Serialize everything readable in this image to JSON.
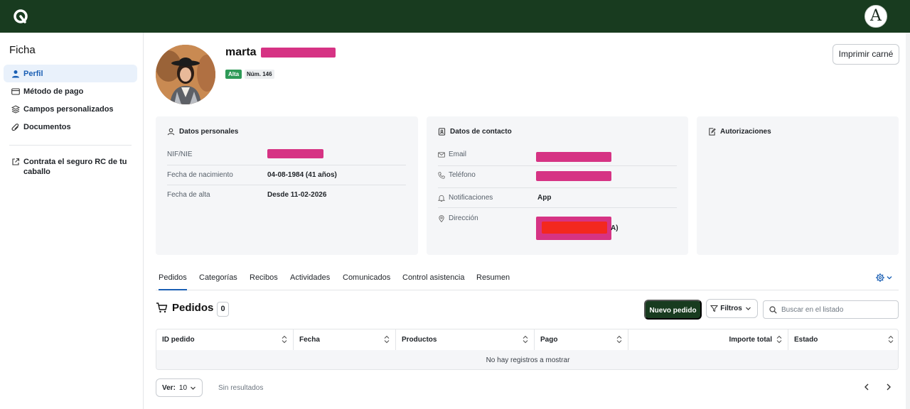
{
  "topbar": {
    "avatar_letter": "A"
  },
  "sidebar": {
    "title": "Ficha",
    "items": [
      {
        "label": "Perfil",
        "icon": "user-icon",
        "active": true
      },
      {
        "label": "Método de pago",
        "icon": "credit-card-icon",
        "active": false
      },
      {
        "label": "Campos personalizados",
        "icon": "layers-icon",
        "active": false
      },
      {
        "label": "Documentos",
        "icon": "paperclip-icon",
        "active": false
      }
    ],
    "external_link": "Contrata el seguro RC de tu caballo"
  },
  "profile": {
    "first_name": "marta",
    "status_badge": "Alta",
    "member_number": "Núm. 146",
    "print_button": "Imprimir carné"
  },
  "cards": {
    "personal": {
      "title": "Datos personales",
      "rows": [
        {
          "label": "NIF/NIE",
          "value": ""
        },
        {
          "label": "Fecha de nacimiento",
          "value": "04-08-1984 (41 años)"
        },
        {
          "label": "Fecha de alta",
          "value": "Desde 11-02-2026"
        }
      ]
    },
    "contact": {
      "title": "Datos de contacto",
      "rows": [
        {
          "label": "Email",
          "icon": "mail-icon",
          "value": ""
        },
        {
          "label": "Teléfono",
          "icon": "phone-icon",
          "value": ""
        },
        {
          "label": "Notificaciones",
          "icon": "bell-icon",
          "value": "App"
        },
        {
          "label": "Dirección",
          "icon": "map-pin-icon",
          "value": "A)"
        }
      ]
    },
    "auth": {
      "title": "Autorizaciones"
    }
  },
  "tabs": [
    "Pedidos",
    "Categorías",
    "Recibos",
    "Actividades",
    "Comunicados",
    "Control asistencia",
    "Resumen"
  ],
  "orders": {
    "title": "Pedidos",
    "count": "0",
    "new_button": "Nuevo pedido",
    "filter_button": "Filtros",
    "search_placeholder": "Buscar en el listado",
    "columns": [
      "ID pedido",
      "Fecha",
      "Productos",
      "Pago",
      "Importe total",
      "Estado"
    ],
    "empty_message": "No hay registros a mostrar",
    "page_size_label": "Ver:",
    "page_size_value": "10",
    "results_text": "Sin resultados"
  },
  "colors": {
    "brand_dark_green": "#183b1f",
    "active_blue": "#1a5fb4",
    "status_green": "#2e9a57",
    "redaction": "#d63384"
  }
}
